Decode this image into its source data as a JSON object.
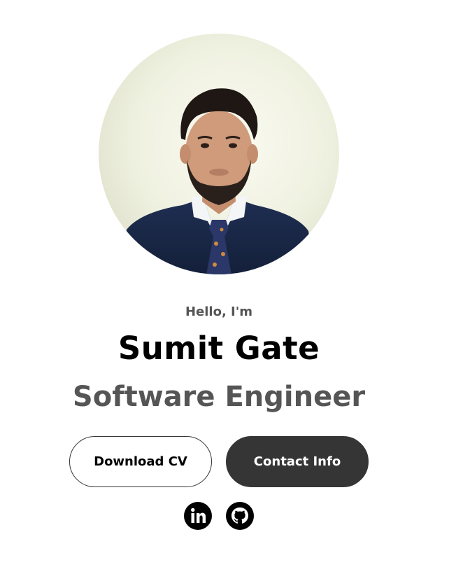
{
  "profile": {
    "greeting": "Hello, I'm",
    "name": "Sumit Gate",
    "title": "Software Engineer",
    "photo_alt": "Sumit Gate profile photo"
  },
  "buttons": {
    "download_cv": "Download CV",
    "contact_info": "Contact Info"
  },
  "social": [
    {
      "icon": "linkedin-icon",
      "label": "LinkedIn"
    },
    {
      "icon": "github-icon",
      "label": "GitHub"
    }
  ],
  "colors": {
    "dark_button": "#353535",
    "muted_text": "#555555",
    "primary_text": "#000000"
  }
}
